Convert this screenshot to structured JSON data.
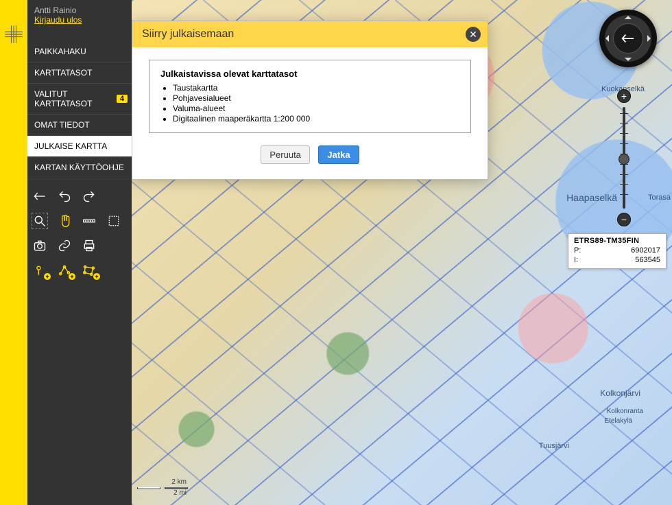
{
  "user": {
    "name": "Antti Rainio",
    "logout": "Kirjaudu ulos"
  },
  "nav": {
    "items": [
      {
        "label": "PAIKKAHAKU"
      },
      {
        "label": "KARTTATASOT"
      },
      {
        "label": "VALITUT KARTTATASOT",
        "badge": "4"
      },
      {
        "label": "OMAT TIEDOT"
      },
      {
        "label": "JULKAISE KARTTA",
        "active": true
      },
      {
        "label": "KARTAN KÄYTTÖOHJE"
      }
    ]
  },
  "dialog": {
    "title": "Siirry julkaisemaan",
    "panel_title": "Julkaistavissa olevat karttatasot",
    "items": [
      "Taustakartta",
      "Pohjavesialueet",
      "Valuma-alueet",
      "Digitaalinen maaperäkartta 1:200 000"
    ],
    "cancel": "Peruuta",
    "continue": "Jatka"
  },
  "coords": {
    "crs": "ETRS89-TM35FIN",
    "p_label": "P:",
    "p_value": "6902017",
    "i_label": "I:",
    "i_value": "563545"
  },
  "scale": {
    "km": "2 km",
    "mi": "2 mi"
  },
  "map_labels": {
    "haapaselka": "Haapaselkä",
    "kolkonjarvi": "Kolkonjärvi",
    "kolkonranta": "Kolkonranta",
    "etelakyla": "Etelakylä",
    "tuusjarvi": "Tuusjärvi",
    "torasalo": "Torasa",
    "kuokanse": "Kuokanselkä"
  }
}
